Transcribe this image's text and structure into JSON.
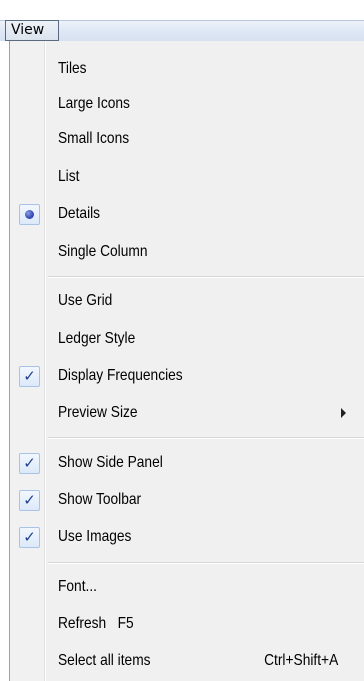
{
  "menubar": {
    "view_label": "View"
  },
  "menu": {
    "items": [
      {
        "label": "Tiles",
        "indicator": "none"
      },
      {
        "label": "Large Icons",
        "indicator": "none"
      },
      {
        "label": "Small Icons",
        "indicator": "none"
      },
      {
        "label": "List",
        "indicator": "none"
      },
      {
        "label": "Details",
        "indicator": "radio",
        "selected": true
      },
      {
        "label": "Single Column",
        "indicator": "none"
      },
      {
        "label": "Use Grid",
        "indicator": "none"
      },
      {
        "label": "Ledger Style",
        "indicator": "none"
      },
      {
        "label": "Display Frequencies",
        "indicator": "check",
        "checked": true
      },
      {
        "label": "Preview Size",
        "indicator": "none",
        "submenu": true
      },
      {
        "label": "Show Side Panel",
        "indicator": "check",
        "checked": true
      },
      {
        "label": "Show Toolbar",
        "indicator": "check",
        "checked": true
      },
      {
        "label": "Use Images",
        "indicator": "check",
        "checked": true
      },
      {
        "label": "Font...",
        "indicator": "none"
      },
      {
        "label": "Refresh   F5",
        "indicator": "none"
      },
      {
        "label": "Select all items",
        "indicator": "none",
        "shortcut": "Ctrl+Shift+A"
      }
    ],
    "check_glyph": "✓",
    "colors": {
      "check": "#1f3f8f",
      "radio": "#3b4fb8",
      "highlight_box": "#a9c2e6"
    }
  }
}
